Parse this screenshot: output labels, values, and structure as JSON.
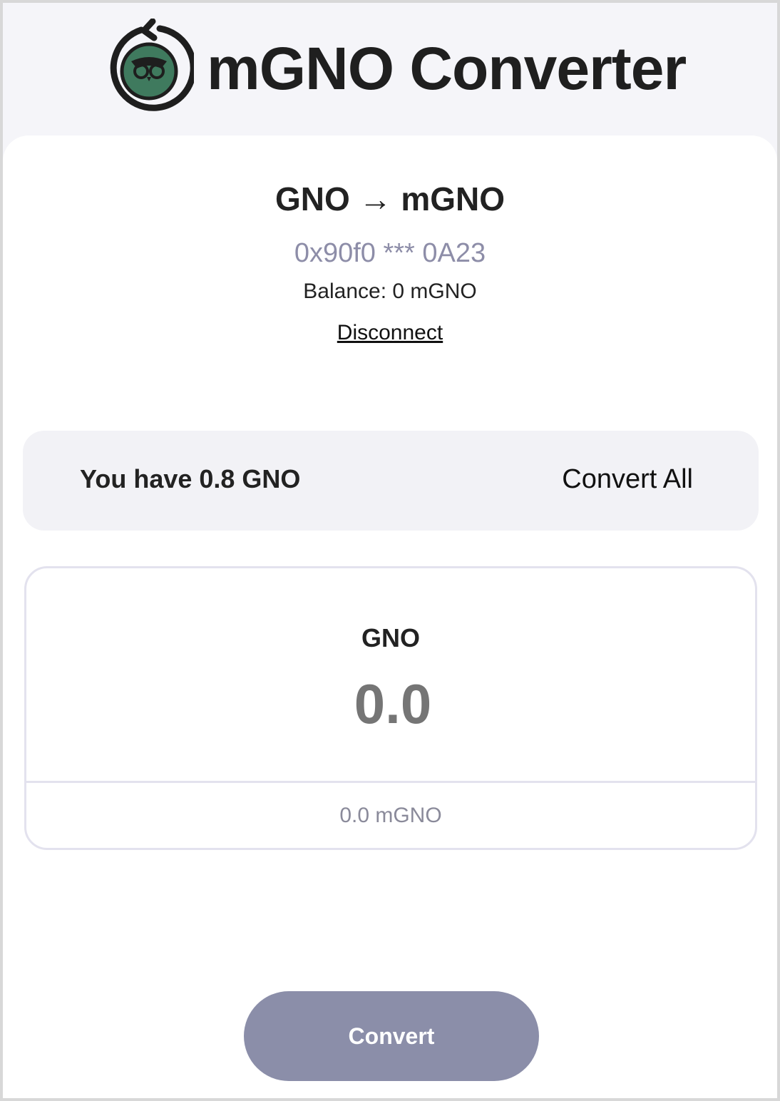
{
  "app": {
    "title": "mGNO Converter",
    "logo_icon": "owl-refresh-logo-icon"
  },
  "converter": {
    "direction": "GNO → mGNO",
    "wallet_address": "0x90f0 *** 0A23",
    "balance_text": "Balance: 0 mGNO",
    "disconnect_label": "Disconnect"
  },
  "holdings": {
    "text": "You have 0.8 GNO",
    "convert_all_label": "Convert All"
  },
  "amount": {
    "token_label": "GNO",
    "value": "0.0",
    "output_text": "0.0 mGNO"
  },
  "actions": {
    "convert_label": "Convert"
  },
  "colors": {
    "brand_green": "#3f7a5e",
    "accent_muted": "#8b8ea9",
    "address_text": "#8d8da8"
  }
}
